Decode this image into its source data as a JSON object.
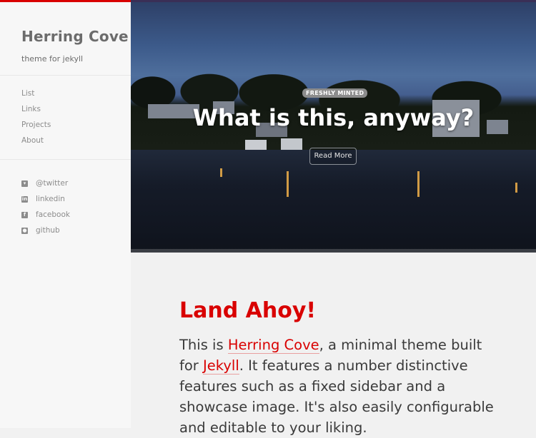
{
  "sidebar": {
    "title": "Herring Cove",
    "tagline": "theme for jekyll",
    "nav": [
      "List",
      "Links",
      "Projects",
      "About"
    ],
    "social": [
      {
        "label": "@twitter",
        "icon": "twitter-icon"
      },
      {
        "label": "linkedin",
        "icon": "linkedin-icon"
      },
      {
        "label": "facebook",
        "icon": "facebook-icon"
      },
      {
        "label": "github",
        "icon": "github-icon"
      }
    ]
  },
  "hero": {
    "badge": "FRESHLY MINTED",
    "title": "What is this, anyway?",
    "button": "Read More"
  },
  "content": {
    "heading": "Land Ahoy!",
    "intro_part1": "This is ",
    "intro_link1": "Herring Cove",
    "intro_part2": ", a minimal theme built for ",
    "intro_link2": "Jekyll",
    "intro_part3": ". It features a number distinctive features such as a fixed sidebar and a showcase image. It's also easily configurable and editable to your liking."
  },
  "colors": {
    "accent": "#d90000",
    "sidebar_bg": "#f7f7f7",
    "page_bg": "#f1f1f1"
  }
}
